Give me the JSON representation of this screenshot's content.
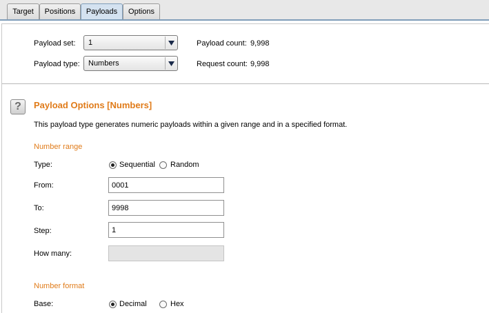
{
  "tabs": [
    {
      "label": "Target"
    },
    {
      "label": "Positions"
    },
    {
      "label": "Payloads"
    },
    {
      "label": "Options"
    }
  ],
  "active_tab": "Payloads",
  "payload_set": {
    "label": "Payload set:",
    "value": "1"
  },
  "payload_type": {
    "label": "Payload type:",
    "value": "Numbers"
  },
  "payload_count": {
    "label": "Payload count:",
    "value": "9,998"
  },
  "request_count": {
    "label": "Request count:",
    "value": "9,998"
  },
  "options": {
    "help_glyph": "?",
    "title": "Payload Options [Numbers]",
    "description": "This payload type generates numeric payloads within a given range and in a specified format.",
    "number_range": {
      "heading": "Number range",
      "type_label": "Type:",
      "type_options": [
        "Sequential",
        "Random"
      ],
      "type_selected": "Sequential",
      "from_label": "From:",
      "from_value": "0001",
      "to_label": "To:",
      "to_value": "9998",
      "step_label": "Step:",
      "step_value": "1",
      "how_many_label": "How many:",
      "how_many_value": ""
    },
    "number_format": {
      "heading": "Number format",
      "base_label": "Base:",
      "base_options": [
        "Decimal",
        "Hex"
      ],
      "base_selected": "Decimal"
    }
  },
  "colors": {
    "accent": "#e07b19",
    "tab_active": "#d4e2f0"
  }
}
